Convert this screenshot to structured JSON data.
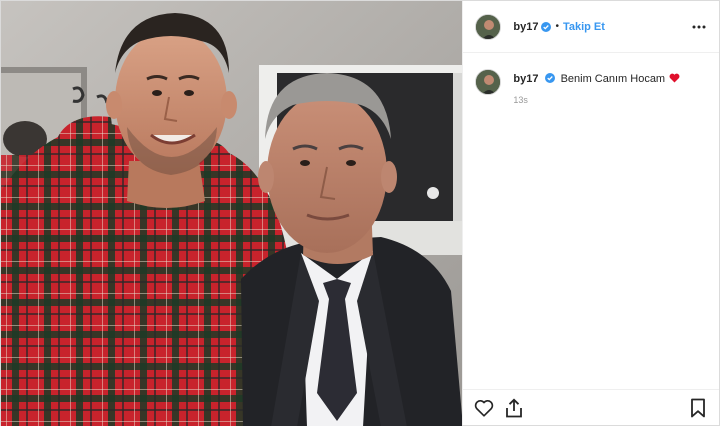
{
  "post": {
    "username": "by17",
    "separator": "•",
    "follow_label": "Takip Et",
    "caption": {
      "username": "by17",
      "text": "Benim Canım Hocam",
      "emoji": "red-heart"
    },
    "timestamp": "13s"
  },
  "icons": {
    "verified": "verified-badge-icon",
    "more": "more-options-icon",
    "like": "heart-icon",
    "share": "share-icon",
    "save": "bookmark-icon"
  },
  "colors": {
    "accent": "#3897f0",
    "verified": "#3897f0",
    "heart": "#ed4956",
    "muted": "#999999",
    "text": "#262626"
  }
}
